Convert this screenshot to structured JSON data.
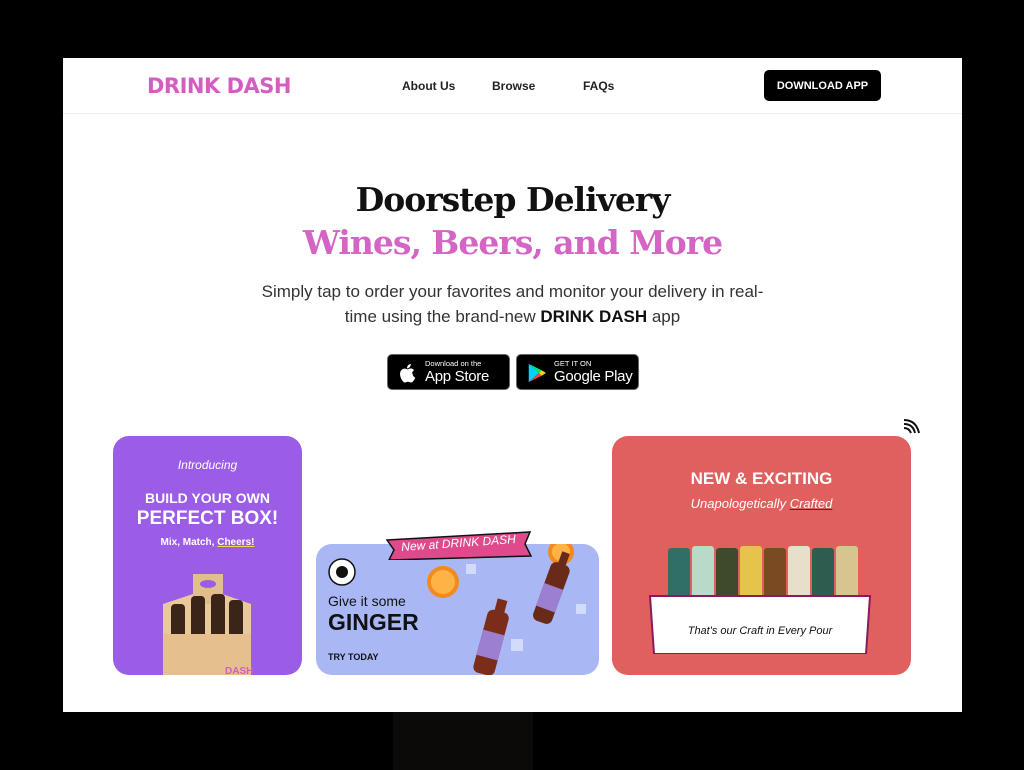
{
  "nav": {
    "logo": "DRINK DASH",
    "links": [
      "About Us",
      "Browse",
      "FAQs"
    ],
    "download_button": "DOWNLOAD APP"
  },
  "hero": {
    "title_line1": "Doorstep Delivery",
    "title_line2": "Wines, Beers, and More",
    "subtitle_before": "Simply tap to order your favorites and monitor your delivery in real-time using the brand-new ",
    "subtitle_brand": "DRINK DASH",
    "subtitle_after": " app"
  },
  "stores": {
    "apple_small": "Download on the",
    "apple_big": "App Store",
    "google_small": "GET IT ON",
    "google_big": "Google Play"
  },
  "cards": {
    "purple": {
      "intro": "Introducing",
      "line1": "BUILD YOUR OWN",
      "line2": "PERFECT BOX!",
      "tagline_before": "Mix, Match, ",
      "tagline_underlined": "Cheers!",
      "box_text": "DASH"
    },
    "blue": {
      "banner": "New at DRINK DASH",
      "give": "Give it some",
      "ginger": "GINGER",
      "cta": "TRY TODAY"
    },
    "red": {
      "headline": "NEW & EXCITING",
      "sub_before": "Unapologetically ",
      "sub_underlined": "Crafted",
      "craft_line": "That's our Craft in Every Pour"
    }
  },
  "colors": {
    "brand_pink": "#d55dc0",
    "purple_card": "#9b5de5",
    "blue_card": "#a9b8f4",
    "red_card": "#e0605e"
  },
  "icons": [
    "apple-icon",
    "google-play-icon",
    "wifi-icon"
  ]
}
